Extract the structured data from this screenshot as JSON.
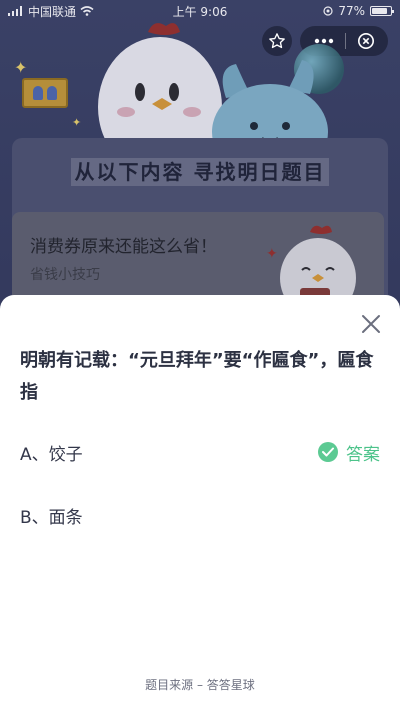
{
  "status_bar": {
    "carrier": "中国联通",
    "time": "上午 9:06",
    "battery": "77%"
  },
  "capsule": {
    "more_icon": "more-dots-icon",
    "close_icon": "target-close-icon",
    "star_icon": "star-outline-icon"
  },
  "background": {
    "headline": "从以下内容 寻找明日题目",
    "promo_title": "消费券原来还能这么省！",
    "promo_subtitle": "省钱小技巧"
  },
  "sheet": {
    "question": "明朝有记载：“元旦拜年”要“作匾食”，匾食指",
    "options": [
      {
        "label": "A、饺子",
        "is_answer": true
      },
      {
        "label": "B、面条",
        "is_answer": false
      }
    ],
    "answer_label": "答案",
    "footer": "题目来源 – 答答星球"
  },
  "colors": {
    "accent_green": "#4cc38a",
    "question_text": "#2c3142",
    "overlay": "#2f3455"
  }
}
